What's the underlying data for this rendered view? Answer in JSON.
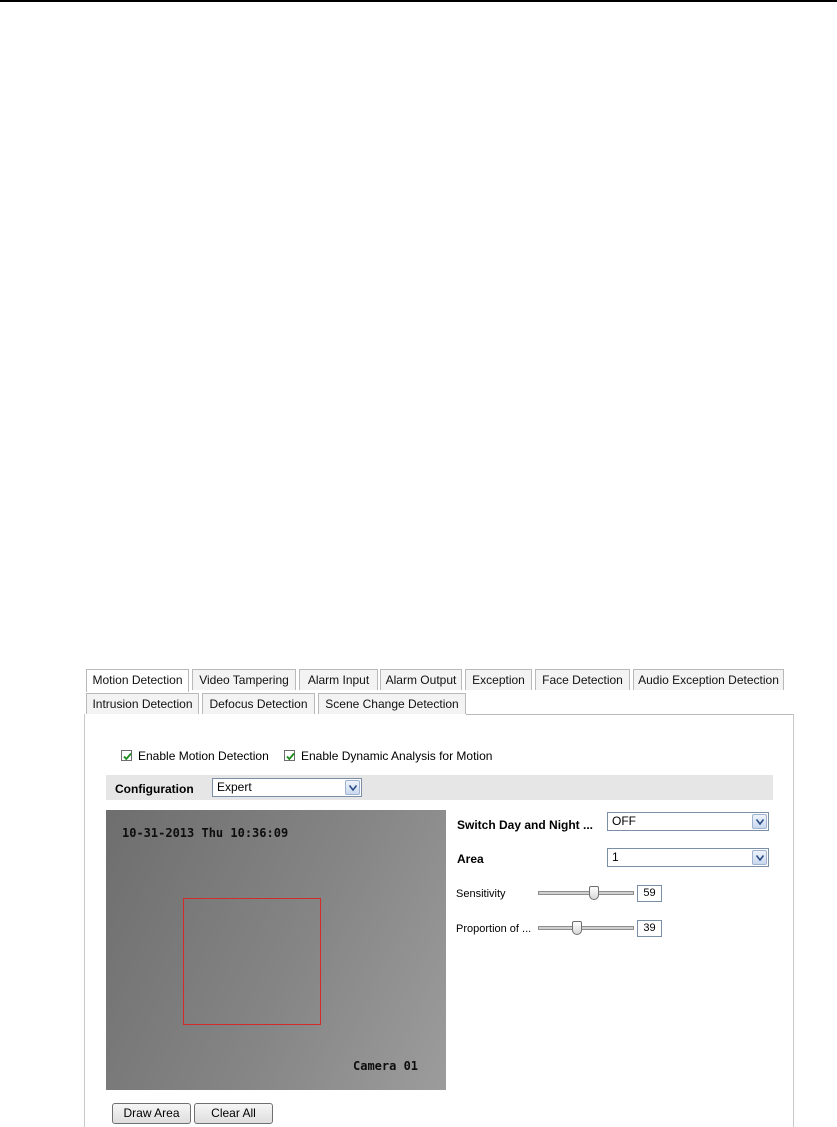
{
  "tabs_row1": [
    "Motion Detection",
    "Video Tampering",
    "Alarm Input",
    "Alarm Output",
    "Exception",
    "Face Detection",
    "Audio Exception Detection"
  ],
  "tabs_row2": [
    "Intrusion Detection",
    "Defocus Detection",
    "Scene Change Detection"
  ],
  "active_tab": "Motion Detection",
  "options": {
    "enable_motion_detection": {
      "label": "Enable Motion Detection",
      "checked": true
    },
    "enable_dynamic_analysis": {
      "label": "Enable Dynamic Analysis for Motion",
      "checked": true
    }
  },
  "configuration": {
    "label": "Configuration",
    "value": "Expert"
  },
  "video": {
    "timestamp": "10-31-2013 Thu 10:36:09",
    "camera_name": "Camera 01",
    "area_color": "#d42a2a"
  },
  "settings": {
    "switch_day_night": {
      "label": "Switch Day and Night ...",
      "value": "OFF"
    },
    "area": {
      "label": "Area",
      "value": "1"
    },
    "sensitivity": {
      "label": "Sensitivity",
      "value": "59",
      "level": 59
    },
    "proportion": {
      "label": "Proportion of ...",
      "value": "39",
      "level": 39
    }
  },
  "buttons": {
    "draw_area": "Draw Area",
    "clear_all": "Clear All"
  }
}
